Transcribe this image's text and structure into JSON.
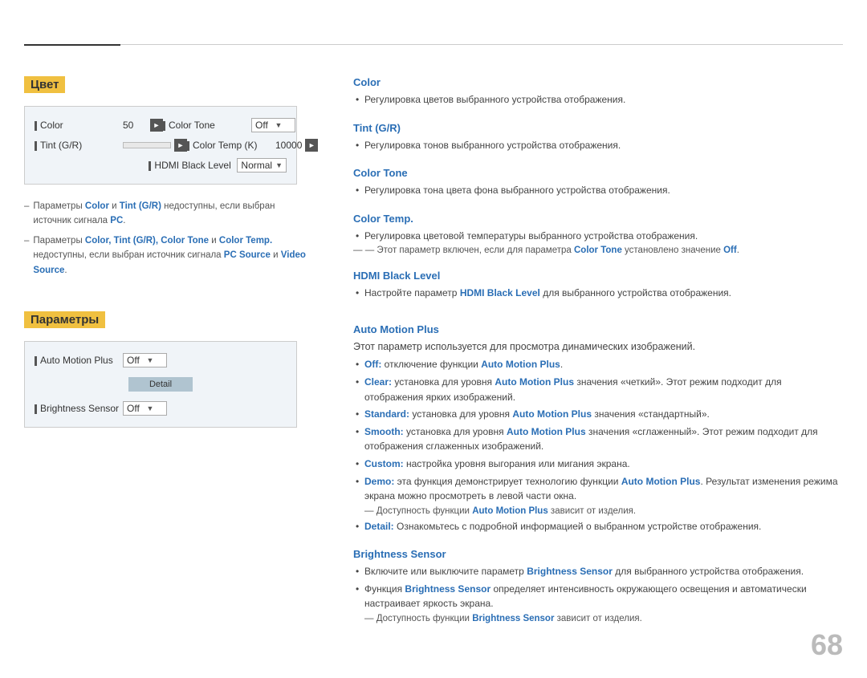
{
  "page": {
    "number": "68"
  },
  "left": {
    "section1": {
      "title": "Цвет",
      "box": {
        "rows": [
          {
            "label": "Color",
            "type": "number-arrows",
            "value": "50",
            "col2label": "Color Tone",
            "col2type": "dropdown",
            "col2value": "Off"
          },
          {
            "label": "Tint (G/R)",
            "type": "bar",
            "col2label": "Color Temp (K)",
            "col2type": "number-arrows",
            "col2value": "10000"
          },
          {
            "label": "",
            "type": "empty",
            "col2label": "HDMI Black Level",
            "col2type": "dropdown",
            "col2value": "Normal"
          }
        ]
      },
      "notes": [
        {
          "text": "Параметры Color и Tint (G/R) недоступны, если выбран источник сигнала PC."
        },
        {
          "text": "Параметры Color, Tint (G/R), Color Tone и Color Temp. недоступны, если выбран источник сигнала PC Source и Video Source."
        }
      ]
    },
    "section2": {
      "title": "Параметры",
      "box": {
        "rows": [
          {
            "label": "Auto Motion Plus",
            "type": "dropdown",
            "value": "Off",
            "showDetail": true
          },
          {
            "label": "Brightness Sensor",
            "type": "dropdown",
            "value": "Off"
          }
        ]
      }
    }
  },
  "right": {
    "sections": [
      {
        "id": "color",
        "title": "Color",
        "bullets": [
          "Регулировка цветов выбранного устройства отображения."
        ]
      },
      {
        "id": "tint",
        "title": "Tint (G/R)",
        "bullets": [
          "Регулировка тонов выбранного устройства отображения."
        ]
      },
      {
        "id": "color-tone",
        "title": "Color Tone",
        "bullets": [
          "Регулировка тона цвета фона выбранного устройства отображения."
        ]
      },
      {
        "id": "color-temp",
        "title": "Color Temp.",
        "bullets": [
          "Регулировка цветовой температуры выбранного устройства отображения."
        ],
        "subnote": "Этот параметр включен, если для параметра Color Tone установлено значение Off."
      },
      {
        "id": "hdmi-black-level",
        "title": "HDMI Black Level",
        "bullets": [
          "Настройте параметр HDMI Black Level для выбранного устройства отображения."
        ]
      },
      {
        "id": "auto-motion-plus",
        "title": "Auto Motion Plus",
        "intro": "Этот параметр используется для просмотра динамических изображений.",
        "bullets": [
          "Off: отключение функции Auto Motion Plus.",
          "Clear: установка для уровня Auto Motion Plus значения «четкий». Этот режим подходит для отображения ярких изображений.",
          "Standard: установка для уровня Auto Motion Plus значения «стандартный».",
          "Smooth: установка для уровня Auto Motion Plus значения «сглаженный». Этот режим подходит для отображения сглаженных изображений.",
          "Custom: настройка уровня выгорания или мигания экрана.",
          "Demo: эта функция демонстрирует технологию функции Auto Motion Plus. Результат изменения режима экрана можно просмотреть в левой части окна."
        ],
        "subnote": "Доступность функции Auto Motion Plus зависит от изделия.",
        "extra_bullet": "Detail: Ознакомьтесь с подробной информацией о выбранном устройстве отображения."
      },
      {
        "id": "brightness-sensor",
        "title": "Brightness Sensor",
        "bullets": [
          "Включите или выключите параметр Brightness Sensor для выбранного устройства отображения.",
          "Функция Brightness Sensor определяет интенсивность окружающего освещения и автоматически настраивает яркость экрана."
        ],
        "subnote": "Доступность функции Brightness Sensor зависит от изделия."
      }
    ]
  }
}
